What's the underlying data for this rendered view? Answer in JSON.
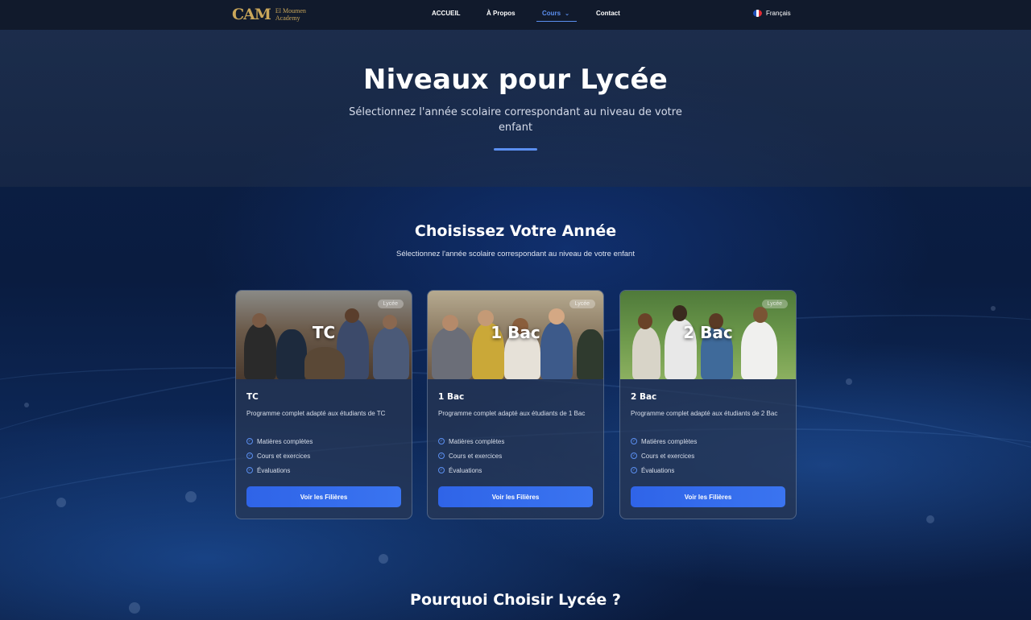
{
  "nav": {
    "logo_mark": "CAM",
    "logo_line1": "El Moumen",
    "logo_line2": "Academy",
    "links": [
      "ACCUEIL",
      "À Propos",
      "Cours",
      "Contact"
    ],
    "language": "Français"
  },
  "hero": {
    "title": "Niveaux pour Lycée",
    "subtitle": "Sélectionnez l'année scolaire correspondant au niveau de votre enfant"
  },
  "section": {
    "title": "Choisissez Votre Année",
    "subtitle": "Sélectionnez l'année scolaire correspondant au niveau de votre enfant"
  },
  "cards": [
    {
      "badge": "Lycée",
      "overlay_title": "TC",
      "title": "TC",
      "description": "Programme complet adapté aux étudiants de TC",
      "features": [
        "Matières complètes",
        "Cours et exercices",
        "Évaluations"
      ],
      "button": "Voir les Filières"
    },
    {
      "badge": "Lycée",
      "overlay_title": "1 Bac",
      "title": "1 Bac",
      "description": "Programme complet adapté aux étudiants de 1 Bac",
      "features": [
        "Matières complètes",
        "Cours et exercices",
        "Évaluations"
      ],
      "button": "Voir les Filières"
    },
    {
      "badge": "Lycée",
      "overlay_title": "2 Bac",
      "title": "2 Bac",
      "description": "Programme complet adapté aux étudiants de 2 Bac",
      "features": [
        "Matières complètes",
        "Cours et exercices",
        "Évaluations"
      ],
      "button": "Voir les Filières"
    }
  ],
  "bottom": {
    "title": "Pourquoi Choisir Lycée ?"
  },
  "colors": {
    "accent": "#5b8ff0",
    "button": "#2f64e8",
    "nav_bg": "#111a2c",
    "logo_gold": "#c9a65a"
  }
}
